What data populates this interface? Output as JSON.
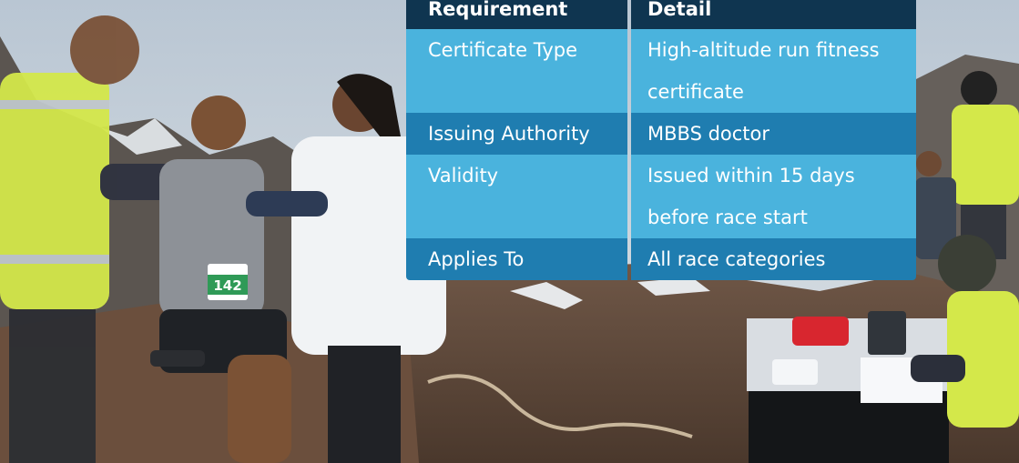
{
  "table": {
    "headers": [
      "Requirement",
      "Detail"
    ],
    "rows": [
      [
        "Certificate Type",
        "High-altitude run fitness"
      ],
      [
        "",
        "certificate"
      ],
      [
        "Issuing Authority",
        "MBBS doctor"
      ],
      [
        "Validity",
        "Issued within 15 days"
      ],
      [
        "",
        "before race start"
      ],
      [
        "Applies To",
        "All race categories"
      ]
    ]
  },
  "photo": {
    "runner_bib": "142"
  },
  "colors": {
    "header_bg": "#0f3550",
    "row_light": "#4ab3dd",
    "row_dark": "#1f7db0",
    "volunteer_vest": "#d4e84a"
  }
}
